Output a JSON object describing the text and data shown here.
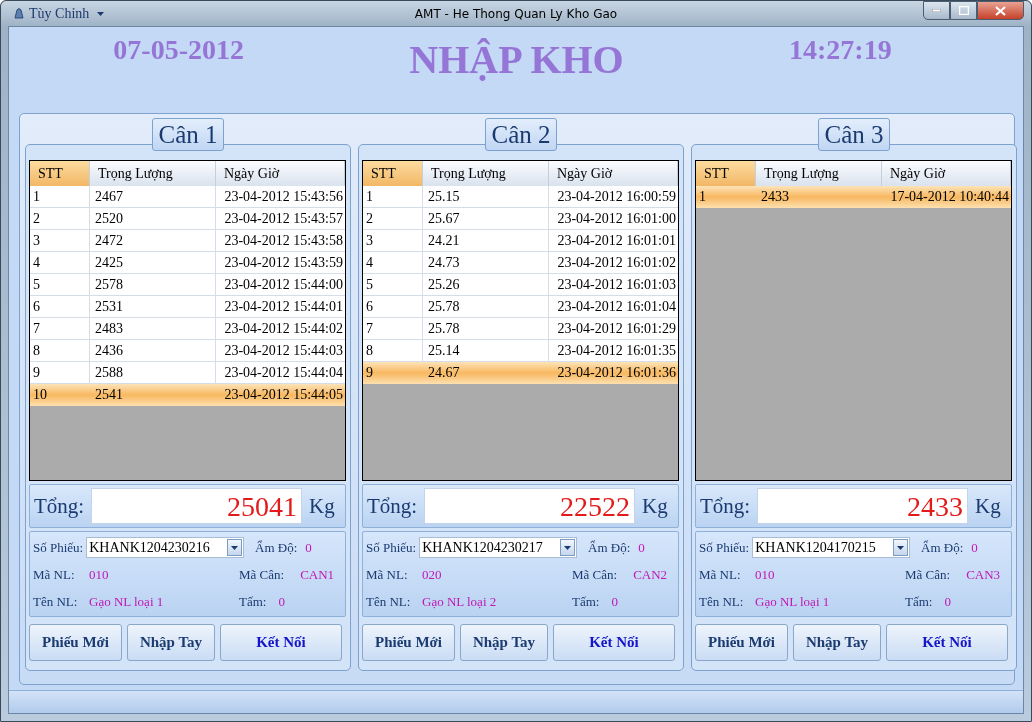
{
  "window": {
    "menu": "Tùy Chỉnh",
    "title": "AMT - He Thong Quan Ly Kho Gao"
  },
  "header": {
    "date": "07-05-2012",
    "title": "NHẬP KHO",
    "time": "14:27:19"
  },
  "scales": [
    {
      "title": "Cân 1",
      "columns": [
        {
          "label": "STT",
          "sorted": true
        },
        {
          "label": "Trọng Lượng",
          "sorted": false
        },
        {
          "label": "Ngày Giờ",
          "sorted": false
        }
      ],
      "rows": [
        {
          "cells": [
            "1",
            "2467",
            "23-04-2012 15:43:56"
          ],
          "selected": false
        },
        {
          "cells": [
            "2",
            "2520",
            "23-04-2012 15:43:57"
          ],
          "selected": false
        },
        {
          "cells": [
            "3",
            "2472",
            "23-04-2012 15:43:58"
          ],
          "selected": false
        },
        {
          "cells": [
            "4",
            "2425",
            "23-04-2012 15:43:59"
          ],
          "selected": false
        },
        {
          "cells": [
            "5",
            "2578",
            "23-04-2012 15:44:00"
          ],
          "selected": false
        },
        {
          "cells": [
            "6",
            "2531",
            "23-04-2012 15:44:01"
          ],
          "selected": false
        },
        {
          "cells": [
            "7",
            "2483",
            "23-04-2012 15:44:02"
          ],
          "selected": false
        },
        {
          "cells": [
            "8",
            "2436",
            "23-04-2012 15:44:03"
          ],
          "selected": false
        },
        {
          "cells": [
            "9",
            "2588",
            "23-04-2012 15:44:04"
          ],
          "selected": false
        },
        {
          "cells": [
            "10",
            "2541",
            "23-04-2012 15:44:05"
          ],
          "selected": true
        }
      ],
      "total_label": "Tổng:",
      "total": "25041",
      "unit": "Kg",
      "info": {
        "ticket_label": "Số Phiếu:",
        "ticket": "KHANK1204230216",
        "moisture_label": "Ẩm Độ:",
        "moisture": "0",
        "material_code_label": "Mã NL:",
        "material_code": "010",
        "scale_code_label": "Mã Cân:",
        "scale_code": "CAN1",
        "material_name_label": "Tên NL:",
        "material_name": "Gạo NL loại 1",
        "broken_label": "Tấm:",
        "broken": "0"
      },
      "buttons": [
        {
          "label": "Phiếu Mới",
          "kind": "normal"
        },
        {
          "label": "Nhập Tay",
          "kind": "normal"
        },
        {
          "label": "Kết Nối",
          "kind": "primary"
        }
      ]
    },
    {
      "title": "Cân 2",
      "columns": [
        {
          "label": "STT",
          "sorted": true
        },
        {
          "label": "Trọng Lượng",
          "sorted": false
        },
        {
          "label": "Ngày Giờ",
          "sorted": false
        }
      ],
      "rows": [
        {
          "cells": [
            "1",
            "25.15",
            "23-04-2012 16:00:59"
          ],
          "selected": false
        },
        {
          "cells": [
            "2",
            "25.67",
            "23-04-2012 16:01:00"
          ],
          "selected": false
        },
        {
          "cells": [
            "3",
            "24.21",
            "23-04-2012 16:01:01"
          ],
          "selected": false
        },
        {
          "cells": [
            "4",
            "24.73",
            "23-04-2012 16:01:02"
          ],
          "selected": false
        },
        {
          "cells": [
            "5",
            "25.26",
            "23-04-2012 16:01:03"
          ],
          "selected": false
        },
        {
          "cells": [
            "6",
            "25.78",
            "23-04-2012 16:01:04"
          ],
          "selected": false
        },
        {
          "cells": [
            "7",
            "25.78",
            "23-04-2012 16:01:29"
          ],
          "selected": false
        },
        {
          "cells": [
            "8",
            "25.14",
            "23-04-2012 16:01:35"
          ],
          "selected": false
        },
        {
          "cells": [
            "9",
            "24.67",
            "23-04-2012 16:01:36"
          ],
          "selected": true
        }
      ],
      "total_label": "Tổng:",
      "total": "22522",
      "unit": "Kg",
      "info": {
        "ticket_label": "Số Phiếu:",
        "ticket": "KHANK1204230217",
        "moisture_label": "Ẩm Độ:",
        "moisture": "0",
        "material_code_label": "Mã NL:",
        "material_code": "020",
        "scale_code_label": "Mã Cân:",
        "scale_code": "CAN2",
        "material_name_label": "Tên NL:",
        "material_name": "Gạo NL loại 2",
        "broken_label": "Tấm:",
        "broken": "0"
      },
      "buttons": [
        {
          "label": "Phiếu Mới",
          "kind": "normal"
        },
        {
          "label": "Nhập Tay",
          "kind": "normal"
        },
        {
          "label": "Kết Nối",
          "kind": "primary"
        }
      ]
    },
    {
      "title": "Cân 3",
      "columns": [
        {
          "label": "STT",
          "sorted": true
        },
        {
          "label": "Trọng Lượng",
          "sorted": false
        },
        {
          "label": "Ngày Giờ",
          "sorted": false
        }
      ],
      "rows": [
        {
          "cells": [
            "1",
            "2433",
            "17-04-2012 10:40:44"
          ],
          "selected": true
        }
      ],
      "total_label": "Tổng:",
      "total": "2433",
      "unit": "Kg",
      "info": {
        "ticket_label": "Số Phiếu:",
        "ticket": "KHANK1204170215",
        "moisture_label": "Ẩm Độ:",
        "moisture": "0",
        "material_code_label": "Mã NL:",
        "material_code": "010",
        "scale_code_label": "Mã Cân:",
        "scale_code": "CAN3",
        "material_name_label": "Tên NL:",
        "material_name": "Gạo NL loại 1",
        "broken_label": "Tấm:",
        "broken": "0"
      },
      "buttons": [
        {
          "label": "Phiếu Mới",
          "kind": "normal"
        },
        {
          "label": "Nhập Tay",
          "kind": "normal"
        },
        {
          "label": "Kết Nối",
          "kind": "primary"
        }
      ]
    }
  ]
}
